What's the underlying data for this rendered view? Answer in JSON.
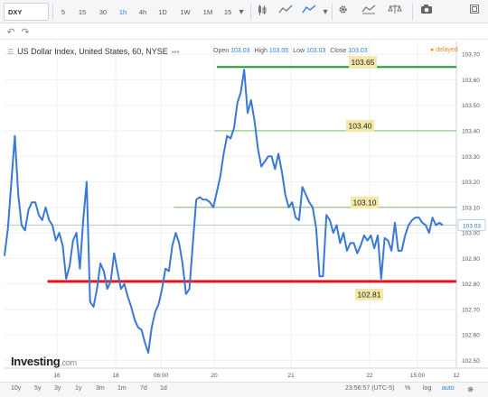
{
  "toolbar": {
    "symbol": "DXY",
    "intervals": [
      "5",
      "15",
      "30",
      "1h",
      "4h",
      "1D",
      "1W",
      "1M",
      "15"
    ],
    "active_interval": "1h",
    "icons": [
      "candlestick-icon",
      "line-chart-icon",
      "area-chart-icon",
      "settings-icon",
      "studies-icon",
      "balance-icon",
      "camera-icon",
      "fullscreen-icon"
    ]
  },
  "subbar": {
    "undo": "↶",
    "redo": "↷"
  },
  "header": {
    "title": "US Dollar Index, United States, 60, NYSE",
    "open_label": "Open",
    "open": "103.03",
    "high_label": "High",
    "high": "103.05",
    "low_label": "Low",
    "low": "103.03",
    "close_label": "Close",
    "close": "103.03",
    "status": "delayed"
  },
  "logo": {
    "main": "Investing",
    "suffix": ".com"
  },
  "colors": {
    "line": "#3a78d6",
    "support": "#e8141a",
    "resistance": "#1e9c2a",
    "thin": "#6ab04c",
    "tag_bg": "#f4e8a8",
    "price_line": "#9ab8d8"
  },
  "chart_data": {
    "type": "line",
    "x_ticks": [
      "16",
      "18",
      "06:00",
      "20",
      "21",
      "22",
      "15:00",
      "12"
    ],
    "y_ticks": [
      "103.70",
      "103.60",
      "103.50",
      "103.40",
      "103.30",
      "103.20",
      "103.10",
      "103.00",
      "102.90",
      "102.80",
      "102.70",
      "102.60",
      "102.50"
    ],
    "ylim": [
      102.47,
      103.75
    ],
    "current_price": "103.03",
    "levels": [
      {
        "label": "103.65",
        "value": 103.65,
        "kind": "resistance-thick",
        "x0": 0.47,
        "x1": 1.0
      },
      {
        "label": "103.40",
        "value": 103.4,
        "kind": "thin",
        "x0": 0.465,
        "x1": 1.0
      },
      {
        "label": "103.10",
        "value": 103.1,
        "kind": "thin",
        "x0": 0.375,
        "x1": 1.0
      },
      {
        "label": "102.81",
        "value": 102.81,
        "kind": "support-thick",
        "x0": 0.095,
        "x1": 1.0
      }
    ],
    "series": [
      {
        "values": [
          102.91,
          103.02,
          103.2,
          103.38,
          103.15,
          103.03,
          103.01,
          103.09,
          103.12,
          103.12,
          103.07,
          103.05,
          103.1,
          103.05,
          103.03,
          102.97,
          103.0,
          102.95,
          102.82,
          102.87,
          102.97,
          103.0,
          102.86,
          103.05,
          103.2,
          102.73,
          102.71,
          102.78,
          102.88,
          102.85,
          102.78,
          102.81,
          102.92,
          102.85,
          102.78,
          102.8,
          102.75,
          102.71,
          102.66,
          102.63,
          102.62,
          102.57,
          102.53,
          102.63,
          102.69,
          102.72,
          102.78,
          102.86,
          102.85,
          102.95,
          103.0,
          102.96,
          102.88,
          102.76,
          102.78,
          102.96,
          103.13,
          103.14,
          103.13,
          103.13,
          103.12,
          103.1,
          103.16,
          103.22,
          103.31,
          103.38,
          103.37,
          103.41,
          103.51,
          103.55,
          103.64,
          103.47,
          103.52,
          103.44,
          103.33,
          103.26,
          103.28,
          103.3,
          103.3,
          103.25,
          103.31,
          103.24,
          103.15,
          103.1,
          103.12,
          103.06,
          103.05,
          103.18,
          103.15,
          103.12,
          103.1,
          103.02,
          102.83,
          102.83,
          103.07,
          103.05,
          103.0,
          103.03,
          102.96,
          103.0,
          102.93,
          102.96,
          102.96,
          102.92,
          102.95,
          102.99,
          102.97,
          102.99,
          102.94,
          102.99,
          102.82,
          102.98,
          102.97,
          102.93,
          103.04,
          102.93,
          102.93,
          102.99,
          103.03,
          103.05,
          103.06,
          103.06,
          103.04,
          103.03,
          103.0,
          103.06,
          103.03,
          103.04,
          103.03
        ]
      }
    ]
  },
  "bottom": {
    "ranges": [
      "10y",
      "5y",
      "3y",
      "1y",
      "3m",
      "1m",
      "7d",
      "1d"
    ],
    "time": "23:56:57 (UTC-5)",
    "percent": "%",
    "log": "log",
    "auto": "auto"
  }
}
